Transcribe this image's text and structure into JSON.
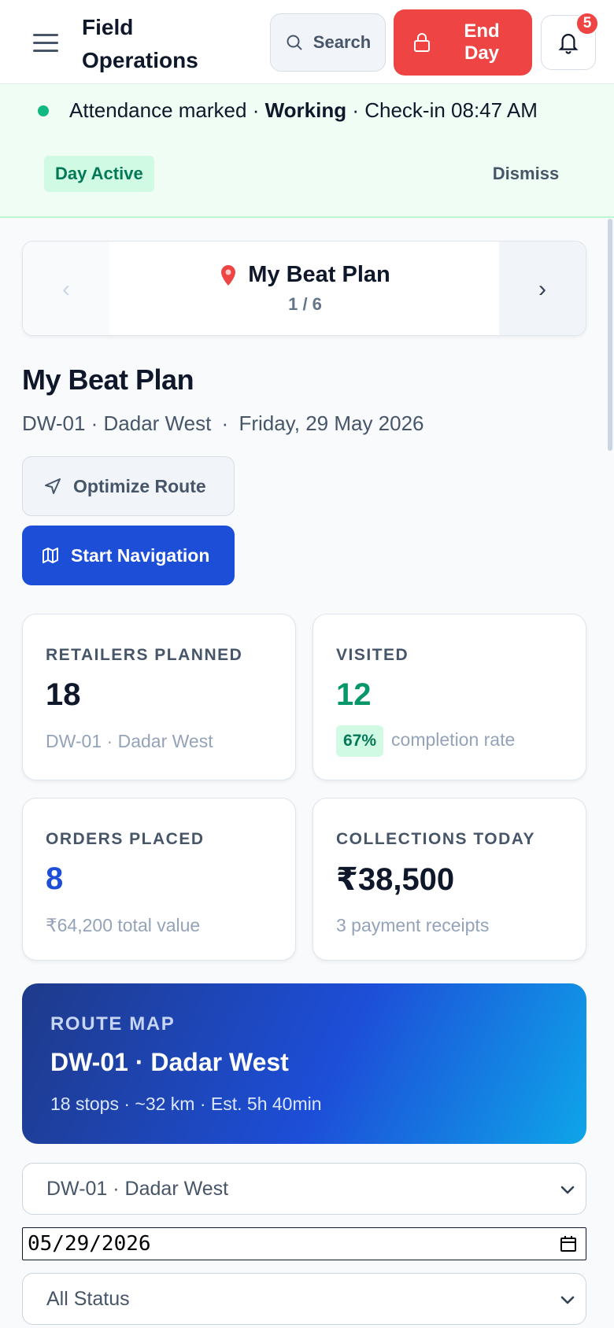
{
  "header": {
    "title": "Field Operations",
    "search_label": "Search",
    "end_day_label": "End Day",
    "notification_count": "5"
  },
  "attendance": {
    "prefix": "Attendance marked · ",
    "state": "Working",
    "suffix": " · Check-in 08:47 AM",
    "badge": "Day Active",
    "dismiss_label": "Dismiss"
  },
  "pager": {
    "prev_glyph": "‹",
    "next_glyph": "›",
    "title": "My Beat Plan",
    "count": "1 / 6"
  },
  "page": {
    "title": "My Beat Plan",
    "beat": "DW-01 · Dadar West",
    "separator": " · ",
    "date": "Friday, 29 May 2026",
    "optimize_label": "Optimize Route",
    "navigate_label": "Start Navigation"
  },
  "stats": {
    "planned": {
      "label": "RETAILERS PLANNED",
      "value": "18",
      "sub": "DW-01 · Dadar West"
    },
    "visited": {
      "label": "VISITED",
      "value": "12",
      "pct": "67%",
      "sub": "completion rate"
    },
    "orders": {
      "label": "ORDERS PLACED",
      "value": "8",
      "sub": "₹64,200 total value"
    },
    "collections": {
      "label": "COLLECTIONS TODAY",
      "value": "₹38,500",
      "sub": "3 payment receipts"
    }
  },
  "route_map": {
    "label": "ROUTE MAP",
    "title": "DW-01 · Dadar West",
    "meta": "18 stops · ~32 km · Est. 5h 40min"
  },
  "filters": {
    "beat_selected": "DW-01 · Dadar West",
    "date_value": "05/29/2026",
    "status_selected": "All Status"
  },
  "colors": {
    "primary": "#1d4ed8",
    "danger": "#ef4444",
    "success": "#059669",
    "ink": "#0f172a"
  }
}
